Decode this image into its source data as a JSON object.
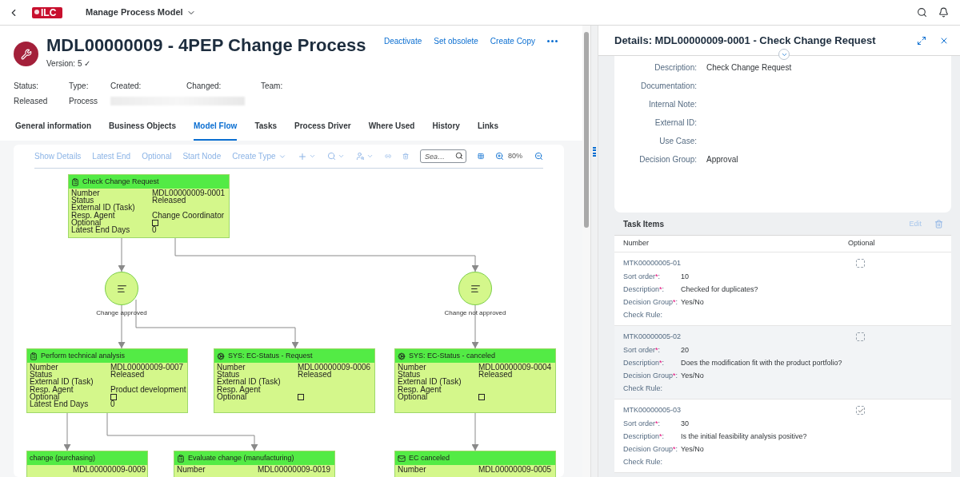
{
  "shell": {
    "logo_text": "ILC",
    "app_title": "Manage Process Model"
  },
  "object": {
    "title": "MDL00000009 - 4PEP Change Process",
    "version": "Version: 5 ✓",
    "actions": [
      "Deactivate",
      "Set obsolete",
      "Create Copy"
    ],
    "attributes": [
      {
        "label": "Status:",
        "value": "Released"
      },
      {
        "label": "Type:",
        "value": "Process"
      },
      {
        "label": "Created:",
        "redacted": true
      },
      {
        "label": "Changed:"
      },
      {
        "label": "Team:"
      }
    ]
  },
  "tabs": [
    {
      "label": "General information",
      "selected": false
    },
    {
      "label": "Business Objects",
      "selected": false
    },
    {
      "label": "Model Flow",
      "selected": true
    },
    {
      "label": "Tasks",
      "selected": false
    },
    {
      "label": "Process Driver",
      "selected": false
    },
    {
      "label": "Where Used",
      "selected": false
    },
    {
      "label": "History",
      "selected": false
    },
    {
      "label": "Links",
      "selected": false
    }
  ],
  "toolbar": {
    "buttons": [
      "Show Details",
      "Latest End",
      "Optional",
      "Start Node"
    ],
    "create_type": "Create Type",
    "search": {
      "placeholder": "Sea…"
    },
    "zoom": "80%"
  },
  "diagram": {
    "nodes": [
      {
        "kind": "task",
        "title": "Check Change Request",
        "rows": [
          {
            "label": "Number",
            "value": "MDL00000009-0001"
          },
          {
            "label": "Status",
            "value": "Released"
          },
          {
            "label": "External ID (Task)"
          },
          {
            "label": "Resp. Agent",
            "value": "Change Coordinator"
          },
          {
            "label": "Optional",
            "checked": false
          },
          {
            "label": "Latest End Days",
            "value": "0"
          }
        ]
      },
      {
        "kind": "task",
        "title": "Perform technical analysis",
        "rows": [
          {
            "label": "Number",
            "value": "MDL00000009-0007"
          },
          {
            "label": "Status",
            "value": "Released"
          },
          {
            "label": "External ID (Task)"
          },
          {
            "label": "Resp. Agent",
            "value": "Product development"
          },
          {
            "label": "Optional",
            "checked": false
          },
          {
            "label": "Latest End Days",
            "value": "0"
          }
        ]
      },
      {
        "kind": "system",
        "title": "SYS: EC-Status - Request",
        "rows": [
          {
            "label": "Number",
            "value": "MDL00000009-0006"
          },
          {
            "label": "Status",
            "value": "Released"
          },
          {
            "label": "External ID (Task)"
          },
          {
            "label": "Resp. Agent"
          },
          {
            "label": "Optional",
            "checked": false
          }
        ]
      },
      {
        "kind": "system",
        "title": "SYS: EC-Status - canceled",
        "rows": [
          {
            "label": "Number",
            "value": "MDL00000009-0004"
          },
          {
            "label": "Status",
            "value": "Released"
          },
          {
            "label": "External ID (Task)"
          },
          {
            "label": "Resp. Agent"
          },
          {
            "label": "Optional",
            "checked": false
          }
        ]
      },
      {
        "kind": "cut",
        "title": "change (purchasing)",
        "rows": [
          {
            "value": "MDL00000009-0009"
          }
        ]
      },
      {
        "kind": "task",
        "title": "Evaluate change (manufacturing)",
        "rows": [
          {
            "label": "Number",
            "value": "MDL00000009-0019"
          }
        ]
      },
      {
        "kind": "mail",
        "title": "EC canceled",
        "rows": [
          {
            "label": "Number",
            "value": "MDL00000009-0005"
          }
        ]
      }
    ],
    "decisions": [
      {
        "label": "Change approved"
      },
      {
        "label": "Change not approved"
      }
    ]
  },
  "details": {
    "title": "Details: MDL00000009-0001 - Check Change Request",
    "fields": [
      {
        "label": "Description:",
        "value": "Check Change Request"
      },
      {
        "label": "Documentation:"
      },
      {
        "label": "Internal Note:"
      },
      {
        "label": "External ID:"
      },
      {
        "label": "Use Case:"
      },
      {
        "label": "Decision Group:",
        "value": "Approval"
      }
    ],
    "task_items": {
      "title": "Task Items",
      "edit": "Edit",
      "columns": [
        "Number",
        "Optional"
      ],
      "rows": [
        {
          "number": "MTK00000005-01",
          "optional": false,
          "selected": false,
          "fields": [
            {
              "label": "Sort order",
              "req": "*",
              "sep": ":",
              "value": "10"
            },
            {
              "label": "Description",
              "req": "*",
              "sep": ":",
              "value": "Checked for duplicates?"
            },
            {
              "label": "Decision Group",
              "req": "*",
              "sep": ":",
              "value": "Yes/No"
            },
            {
              "label": "Check Rule:"
            }
          ]
        },
        {
          "number": "MTK00000005-02",
          "optional": false,
          "selected": true,
          "fields": [
            {
              "label": "Sort order",
              "req": "*",
              "sep": ":",
              "value": "20"
            },
            {
              "label": "Description",
              "req": "*",
              "sep": ":",
              "value": "Does the modification fit with the product portfolio?"
            },
            {
              "label": "Decision Group",
              "req": "*",
              "sep": ":",
              "value": "Yes/No"
            },
            {
              "label": "Check Rule:"
            }
          ]
        },
        {
          "number": "MTK00000005-03",
          "optional": true,
          "selected": false,
          "fields": [
            {
              "label": "Sort order",
              "req": "*",
              "sep": ":",
              "value": "30"
            },
            {
              "label": "Description",
              "req": "*",
              "sep": ":",
              "value": "Is the initial feasibility analysis positive?"
            },
            {
              "label": "Decision Group",
              "req": "*",
              "sep": ":",
              "value": "Yes/No"
            },
            {
              "label": "Check Rule:"
            }
          ]
        }
      ]
    }
  }
}
